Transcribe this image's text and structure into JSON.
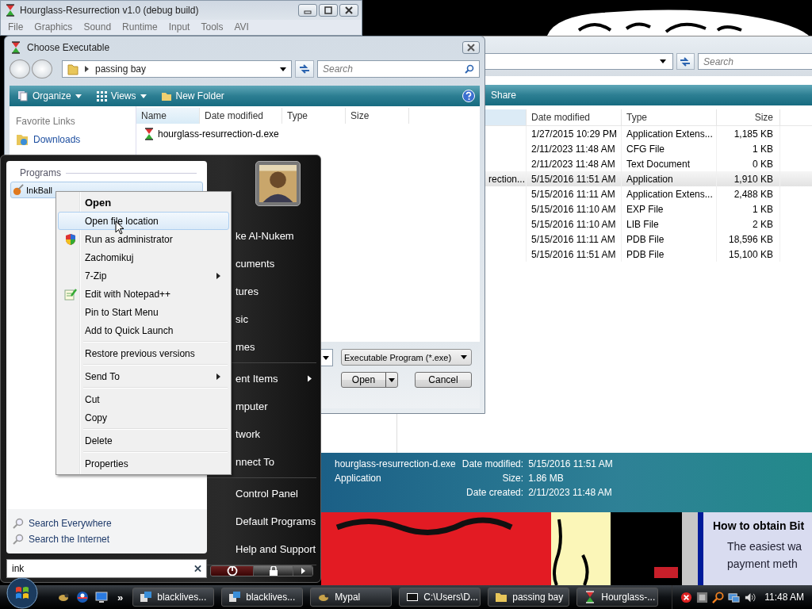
{
  "main_window": {
    "title": "Hourglass-Resurrection v1.0 (debug build)",
    "menu": [
      "File",
      "Graphics",
      "Sound",
      "Runtime",
      "Input",
      "Tools",
      "AVI"
    ]
  },
  "explorer": {
    "search": {
      "placeholder": "Search"
    },
    "command_bar": [
      "Share"
    ],
    "columns": [
      "Date modified",
      "Type",
      "Size"
    ],
    "rows": [
      {
        "date": "1/27/2015 10:29 PM",
        "type": "Application Extens...",
        "size": "1,185 KB",
        "selected": false
      },
      {
        "date": "2/11/2023 11:48 AM",
        "type": "CFG File",
        "size": "1 KB",
        "selected": false
      },
      {
        "date": "2/11/2023 11:48 AM",
        "type": "Text Document",
        "size": "0 KB",
        "selected": false
      },
      {
        "name": "rection...",
        "date": "5/15/2016 11:51 AM",
        "type": "Application",
        "size": "1,910 KB",
        "selected": true
      },
      {
        "date": "5/15/2016 11:11 AM",
        "type": "Application Extens...",
        "size": "2,488 KB",
        "selected": false
      },
      {
        "date": "5/15/2016 11:10 AM",
        "type": "EXP File",
        "size": "1 KB",
        "selected": false
      },
      {
        "date": "5/15/2016 11:10 AM",
        "type": "LIB File",
        "size": "2 KB",
        "selected": false
      },
      {
        "date": "5/15/2016 11:11 AM",
        "type": "PDB File",
        "size": "18,596 KB",
        "selected": false
      },
      {
        "date": "5/15/2016 11:51 AM",
        "type": "PDB File",
        "size": "15,100 KB",
        "selected": false
      }
    ],
    "details": {
      "name": "hourglass-resurrection-d.exe",
      "type": "Application",
      "fields": [
        {
          "label": "Date modified:",
          "value": "5/15/2016 11:51 AM"
        },
        {
          "label": "Size:",
          "value": "1.86 MB"
        },
        {
          "label": "Date created:",
          "value": "2/11/2023 11:48 AM"
        }
      ]
    }
  },
  "dialog": {
    "title": "Choose Executable",
    "path": "passing bay",
    "search": {
      "placeholder": "Search"
    },
    "toolbar": [
      {
        "label": "Organize",
        "kind": "organize"
      },
      {
        "label": "Views",
        "kind": "views"
      },
      {
        "label": "New Folder",
        "kind": "folder"
      }
    ],
    "favorite_links": {
      "title": "Favorite Links",
      "items": [
        "Downloads"
      ]
    },
    "columns": [
      "Name",
      "Date modified",
      "Type",
      "Size"
    ],
    "files": [
      "hourglass-resurrection-d.exe"
    ],
    "file_type": "Executable Program (*.exe)",
    "buttons": [
      {
        "label": "Open",
        "split": true
      },
      {
        "label": "Cancel",
        "split": false
      }
    ]
  },
  "start_menu": {
    "programs_title": "Programs",
    "programs": [
      {
        "label": "InkBall",
        "selected": true
      }
    ],
    "search_links": [
      "Search Everywhere",
      "Search the Internet"
    ],
    "search": {
      "value": "ink"
    },
    "places": [
      [
        {
          "label": "ke Al-Nukem",
          "submenu": false
        },
        {
          "label": "cuments",
          "submenu": false
        },
        {
          "label": "tures",
          "submenu": false
        },
        {
          "label": "sic",
          "submenu": false
        },
        {
          "label": "mes",
          "submenu": false
        }
      ],
      [
        {
          "label": "ent Items",
          "submenu": true
        },
        {
          "label": "mputer",
          "submenu": false
        },
        {
          "label": "twork",
          "submenu": false
        },
        {
          "label": "nnect To",
          "submenu": false
        }
      ],
      [
        {
          "label": "Control Panel",
          "submenu": false
        },
        {
          "label": "Default Programs",
          "submenu": false
        },
        {
          "label": "Help and Support",
          "submenu": false
        }
      ]
    ]
  },
  "context_menu": {
    "groups": [
      [
        {
          "label": "Open",
          "kind": "default",
          "selected": false,
          "submenu": false
        },
        {
          "label": "Open file location",
          "kind": "plain",
          "selected": true,
          "submenu": false
        },
        {
          "label": "Run as administrator",
          "kind": "elevated",
          "selected": false,
          "submenu": false
        },
        {
          "label": "Zachomikuj",
          "kind": "plain",
          "selected": false,
          "submenu": false
        },
        {
          "label": "7-Zip",
          "kind": "plain",
          "selected": false,
          "submenu": true
        },
        {
          "label": "Edit with Notepad++",
          "kind": "editor",
          "selected": false,
          "submenu": false
        },
        {
          "label": "Pin to Start Menu",
          "kind": "plain",
          "selected": false,
          "submenu": false
        },
        {
          "label": "Add to Quick Launch",
          "kind": "plain",
          "selected": false,
          "submenu": false
        }
      ],
      [
        {
          "label": "Restore previous versions",
          "kind": "plain",
          "selected": false,
          "submenu": false
        }
      ],
      [
        {
          "label": "Send To",
          "kind": "plain",
          "selected": false,
          "submenu": true
        }
      ],
      [
        {
          "label": "Cut",
          "kind": "plain",
          "selected": false,
          "submenu": false
        },
        {
          "label": "Copy",
          "kind": "plain",
          "selected": false,
          "submenu": false
        }
      ],
      [
        {
          "label": "Delete",
          "kind": "plain",
          "selected": false,
          "submenu": false
        }
      ],
      [
        {
          "label": "Properties",
          "kind": "plain",
          "selected": false,
          "submenu": false
        }
      ]
    ]
  },
  "web_page": {
    "heading": "How to obtain Bit",
    "lines": [
      "The easiest wa",
      "payment meth"
    ]
  },
  "taskbar": {
    "overflow": "»",
    "tasks": [
      {
        "label": "blacklives...",
        "kind": "web"
      },
      {
        "label": "blacklives...",
        "kind": "web"
      },
      {
        "label": "Mypal",
        "kind": "browser"
      },
      {
        "label": "C:\\Users\\D...",
        "kind": "archive"
      },
      {
        "label": "passing bay",
        "kind": "folder"
      },
      {
        "label": "Hourglass-...",
        "kind": "app"
      }
    ],
    "clock": "11:48 AM"
  }
}
